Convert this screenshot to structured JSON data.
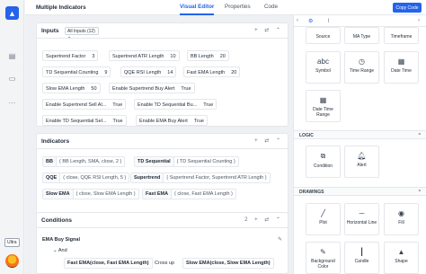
{
  "app": {
    "title": "Multiple Indicators",
    "tabs": [
      "Visual Editor",
      "Properties",
      "Code"
    ],
    "copy_button": "Copy Code",
    "plan_badge": "Ultra"
  },
  "inputs": {
    "title": "Inputs",
    "filter": "All Inputs (12)",
    "items": [
      {
        "label": "Supertrend Factor",
        "value": "3"
      },
      {
        "label": "Supertrend ATR Length",
        "value": "10"
      },
      {
        "label": "BB Length",
        "value": "20"
      },
      {
        "label": "TD Sequential Counting",
        "value": "9"
      },
      {
        "label": "QQE RSI Length",
        "value": "14"
      },
      {
        "label": "Fast EMA Length",
        "value": "20"
      },
      {
        "label": "Slow EMA Length",
        "value": "50"
      },
      {
        "label": "Enable Supertrend Buy Alert",
        "value": "True"
      },
      {
        "label": "Enable Supertrend Sell Al...",
        "value": "True"
      },
      {
        "label": "Enable TD Sequential Bu...",
        "value": "True"
      },
      {
        "label": "Enable TD Sequential Sel...",
        "value": "True"
      },
      {
        "label": "Enable EMA Buy Alert",
        "value": "True"
      }
    ]
  },
  "indicators": {
    "title": "Indicators",
    "items": [
      {
        "name": "BB",
        "args": "( BB Length, SMA, close, 2 )"
      },
      {
        "name": "TD Sequential",
        "args": "( TD Sequential Counting )"
      },
      {
        "name": "QQE",
        "args": "( close, QQE RSI Length, 5 )"
      },
      {
        "name": "Supertrend",
        "args": "( Supertrend Factor, Supertrend ATR Length )"
      },
      {
        "name": "Slow EMA",
        "args": "( close, Slow EMA Length )"
      },
      {
        "name": "Fast EMA",
        "args": "( close, Fast EMA Length )"
      }
    ]
  },
  "conditions": {
    "title": "Conditions",
    "count": "2",
    "condition_name": "EMA Buy Signal",
    "logic": "And",
    "left": "Fast EMA(close, Fast EMA Length)",
    "operator": "Cross up",
    "right": "Slow EMA(close, Slow EMA Length)"
  },
  "toolbox": {
    "top_tiles": [
      "Source",
      "MA Type",
      "Timeframe",
      "Symbol",
      "Time Range",
      "Date Time",
      "Date Time Range"
    ],
    "logic_title": "LOGIC",
    "logic_tiles": [
      "Condition",
      "Alert"
    ],
    "drawings_title": "DRAWINGS",
    "drawing_tiles": [
      "Plot",
      "Horizontal Line",
      "Fill",
      "Background Color",
      "Candle",
      "Shape"
    ]
  }
}
